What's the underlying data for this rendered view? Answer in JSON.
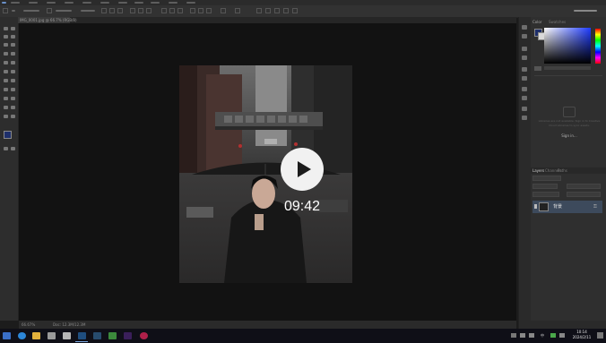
{
  "app": {
    "title": "Photoshop"
  },
  "menu_bar": {
    "items": [
      "File",
      "Edit",
      "Image",
      "Layer",
      "Type",
      "Select",
      "Filter",
      "3D",
      "View",
      "Window",
      "Help"
    ]
  },
  "document": {
    "tab_label": "IMG_0001.jpg @ 66.7% (RGB/8)",
    "zoom": "66.67%",
    "doc_info": "Doc: 12.3M/12.3M"
  },
  "video_overlay": {
    "duration": "09:42",
    "play_icon": "play-icon"
  },
  "panels": {
    "color_tab": "Color",
    "swatches_tab": "Swatches",
    "cc_libraries_text": "Libraries are not available. Sign in to Creative Cloud Libraries to sync assets.",
    "cc_libraries_link": "Sign in...",
    "layers_tab": "Layers",
    "channels_tab": "Channels",
    "paths_tab": "Paths",
    "layer_name": "背景",
    "colors": {
      "foreground": "#1e2f6b",
      "background": "#d9d9d9"
    }
  },
  "taskbar": {
    "time": "10:14",
    "date": "2024/2/11",
    "lang": "中"
  }
}
